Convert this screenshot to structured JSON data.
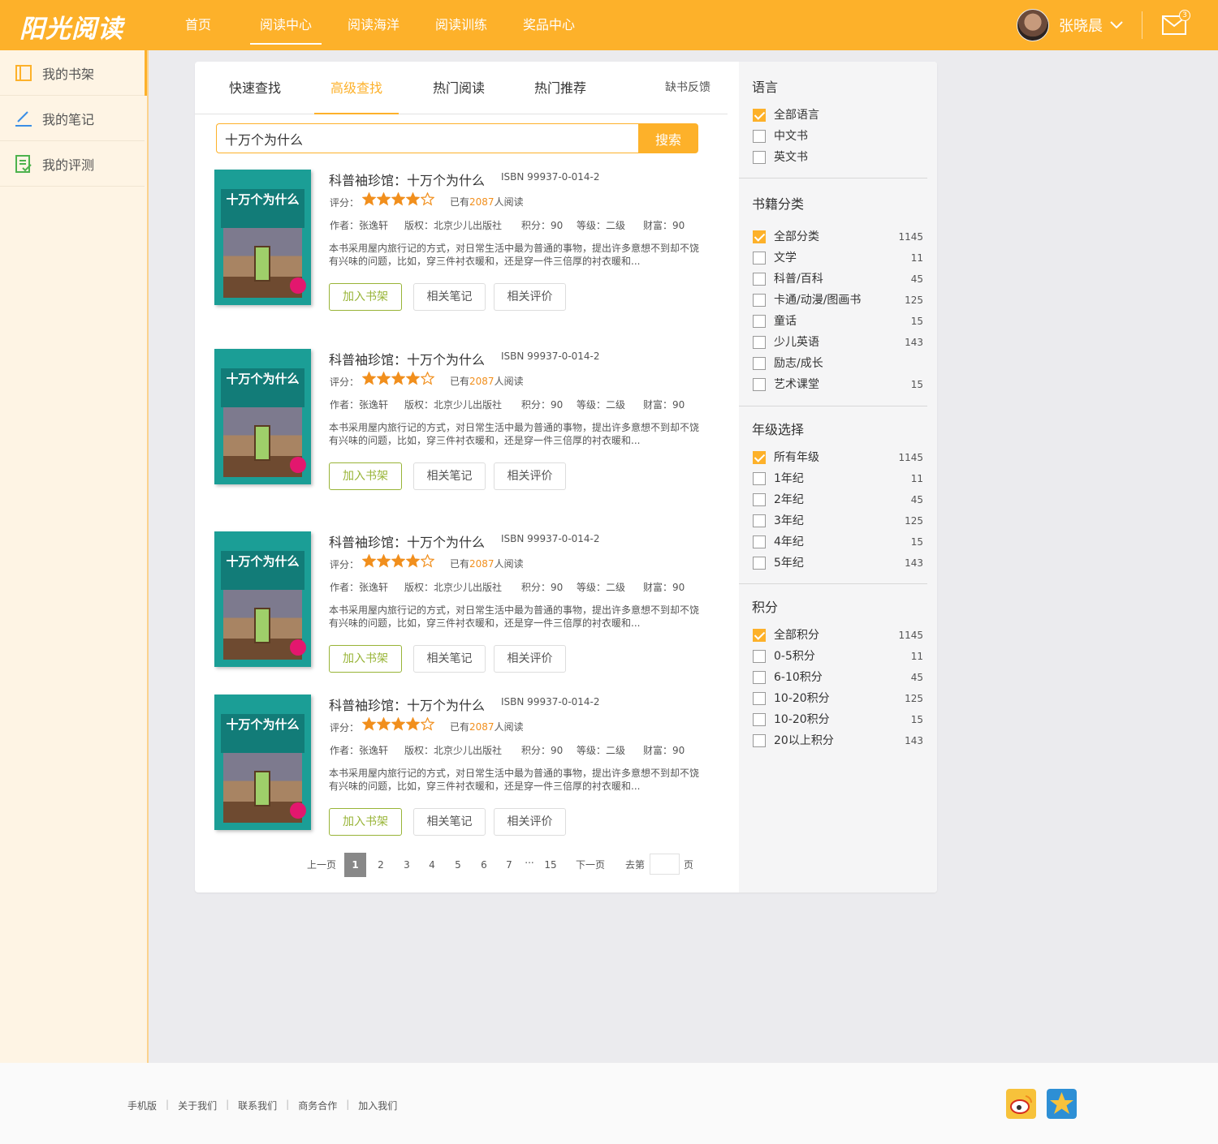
{
  "header": {
    "logo": "阳光阅读",
    "nav": [
      "首页",
      "阅读中心",
      "阅读海洋",
      "阅读训练",
      "奖品中心"
    ],
    "active_nav": "阅读中心",
    "username": "张晓晨",
    "mail_count": "3"
  },
  "sidebar": {
    "items": [
      {
        "label": "我的书架",
        "icon": "bookshelf-icon"
      },
      {
        "label": "我的笔记",
        "icon": "pencil-icon"
      },
      {
        "label": "我的评测",
        "icon": "checklist-icon"
      }
    ]
  },
  "tabs": {
    "items": [
      "快速查找",
      "高级查找",
      "热门阅读",
      "热门推荐"
    ],
    "active": "高级查找",
    "feedback": "缺书反馈"
  },
  "search": {
    "value": "十万个为什么",
    "button": "搜索"
  },
  "books": [
    {
      "title": "科普袖珍馆：十万个为什么",
      "isbn": "ISBN 99937-0-014-2",
      "rating_label": "评分：",
      "rating": 4,
      "read_prefix": "已有",
      "read_count": "2087",
      "read_suffix": "人阅读",
      "author": "作者：张逸轩",
      "publisher": "版权：北京少儿出版社",
      "points": "积分：90",
      "level": "等级：二级",
      "wealth": "财富：90",
      "desc": "本书采用屋内旅行记的方式，对日常生活中最为普通的事物，提出许多意想不到却不饶有兴味的问题，比如，穿三件衬衣暖和，还是穿一件三倍厚的衬衣暖和...",
      "cover_title": "十万个为什么",
      "btn_shelf": "加入书架",
      "btn_notes": "相关笔记",
      "btn_reviews": "相关评价"
    },
    {
      "title": "科普袖珍馆：十万个为什么",
      "isbn": "ISBN 99937-0-014-2",
      "rating_label": "评分：",
      "rating": 4,
      "read_prefix": "已有",
      "read_count": "2087",
      "read_suffix": "人阅读",
      "author": "作者：张逸轩",
      "publisher": "版权：北京少儿出版社",
      "points": "积分：90",
      "level": "等级：二级",
      "wealth": "财富：90",
      "desc": "本书采用屋内旅行记的方式，对日常生活中最为普通的事物，提出许多意想不到却不饶有兴味的问题，比如，穿三件衬衣暖和，还是穿一件三倍厚的衬衣暖和...",
      "cover_title": "十万个为什么",
      "btn_shelf": "加入书架",
      "btn_notes": "相关笔记",
      "btn_reviews": "相关评价"
    },
    {
      "title": "科普袖珍馆：十万个为什么",
      "isbn": "ISBN 99937-0-014-2",
      "rating_label": "评分：",
      "rating": 4,
      "read_prefix": "已有",
      "read_count": "2087",
      "read_suffix": "人阅读",
      "author": "作者：张逸轩",
      "publisher": "版权：北京少儿出版社",
      "points": "积分：90",
      "level": "等级：二级",
      "wealth": "财富：90",
      "desc": "本书采用屋内旅行记的方式，对日常生活中最为普通的事物，提出许多意想不到却不饶有兴味的问题，比如，穿三件衬衣暖和，还是穿一件三倍厚的衬衣暖和...",
      "cover_title": "十万个为什么",
      "btn_shelf": "加入书架",
      "btn_notes": "相关笔记",
      "btn_reviews": "相关评价"
    },
    {
      "title": "科普袖珍馆：十万个为什么",
      "isbn": "ISBN 99937-0-014-2",
      "rating_label": "评分：",
      "rating": 4,
      "read_prefix": "已有",
      "read_count": "2087",
      "read_suffix": "人阅读",
      "author": "作者：张逸轩",
      "publisher": "版权：北京少儿出版社",
      "points": "积分：90",
      "level": "等级：二级",
      "wealth": "财富：90",
      "desc": "本书采用屋内旅行记的方式，对日常生活中最为普通的事物，提出许多意想不到却不饶有兴味的问题，比如，穿三件衬衣暖和，还是穿一件三倍厚的衬衣暖和...",
      "cover_title": "十万个为什么",
      "btn_shelf": "加入书架",
      "btn_notes": "相关笔记",
      "btn_reviews": "相关评价"
    }
  ],
  "pagination": {
    "prev": "上一页",
    "pages": [
      "1",
      "2",
      "3",
      "4",
      "5",
      "6",
      "7"
    ],
    "ellipsis": "...",
    "last": "15",
    "current": "1",
    "next": "下一页",
    "goto_prefix": "去第",
    "goto_suffix": "页"
  },
  "filters": [
    {
      "title": "语言",
      "options": [
        {
          "label": "全部语言",
          "count": "",
          "checked": true
        },
        {
          "label": "中文书",
          "count": "",
          "checked": false
        },
        {
          "label": "英文书",
          "count": "",
          "checked": false
        }
      ]
    },
    {
      "title": "书籍分类",
      "options": [
        {
          "label": "全部分类",
          "count": "1145",
          "checked": true
        },
        {
          "label": "文学",
          "count": "11",
          "checked": false
        },
        {
          "label": "科普/百科",
          "count": "45",
          "checked": false
        },
        {
          "label": "卡通/动漫/图画书",
          "count": "125",
          "checked": false
        },
        {
          "label": "童话",
          "count": "15",
          "checked": false
        },
        {
          "label": "少儿英语",
          "count": "143",
          "checked": false
        },
        {
          "label": "励志/成长",
          "count": "",
          "checked": false
        },
        {
          "label": "艺术课堂",
          "count": "15",
          "checked": false
        }
      ]
    },
    {
      "title": "年级选择",
      "options": [
        {
          "label": "所有年级",
          "count": "1145",
          "checked": true
        },
        {
          "label": "1年纪",
          "count": "11",
          "checked": false
        },
        {
          "label": "2年纪",
          "count": "45",
          "checked": false
        },
        {
          "label": "3年纪",
          "count": "125",
          "checked": false
        },
        {
          "label": "4年纪",
          "count": "15",
          "checked": false
        },
        {
          "label": "5年纪",
          "count": "143",
          "checked": false
        }
      ]
    },
    {
      "title": "积分",
      "options": [
        {
          "label": "全部积分",
          "count": "1145",
          "checked": true
        },
        {
          "label": "0-5积分",
          "count": "11",
          "checked": false
        },
        {
          "label": "6-10积分",
          "count": "45",
          "checked": false
        },
        {
          "label": "10-20积分",
          "count": "125",
          "checked": false
        },
        {
          "label": "10-20积分",
          "count": "15",
          "checked": false
        },
        {
          "label": "20以上积分",
          "count": "143",
          "checked": false
        }
      ]
    }
  ],
  "footer": {
    "links": [
      "手机版",
      "关于我们",
      "联系我们",
      "商务合作",
      "加入我们"
    ],
    "social": [
      "weibo-icon",
      "qzone-icon"
    ]
  },
  "colors": {
    "brand": "#fdb12a",
    "accent_green": "#98b437",
    "star": "#f18f1d"
  }
}
